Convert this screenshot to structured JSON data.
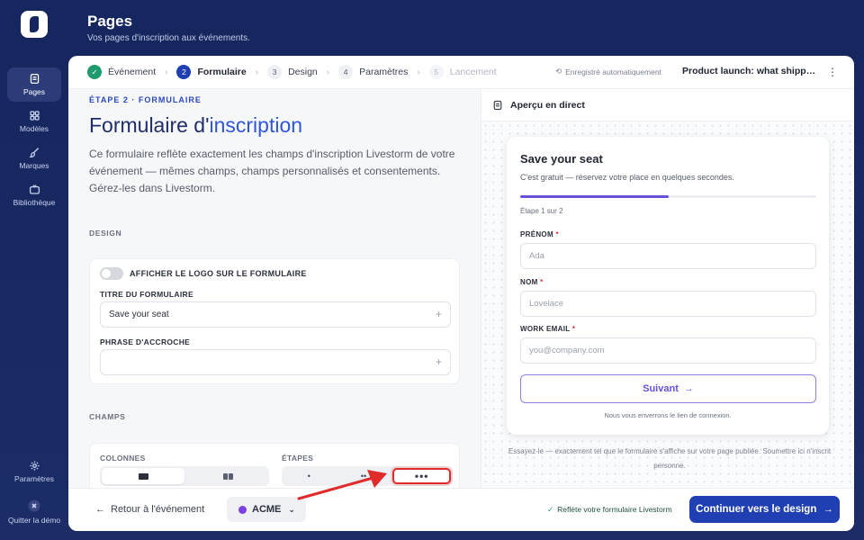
{
  "app": {
    "title": "Pages",
    "subtitle": "Vos pages d'inscription aux événements."
  },
  "sidebar": {
    "items": [
      {
        "label": "Pages",
        "icon": "pages-icon",
        "active": true
      },
      {
        "label": "Modèles",
        "icon": "grid-icon",
        "active": false
      },
      {
        "label": "Marques",
        "icon": "brush-icon",
        "active": false
      },
      {
        "label": "Bibliothèque",
        "icon": "tv-icon",
        "active": false
      }
    ],
    "bottom_items": [
      {
        "label": "Paramètres",
        "icon": "gear-icon"
      },
      {
        "label": "Quitter la démo",
        "icon": "exit-icon"
      }
    ]
  },
  "stepper": {
    "steps": [
      {
        "num": "1",
        "label": "Événement",
        "state": "done"
      },
      {
        "num": "2",
        "label": "Formulaire",
        "state": "current"
      },
      {
        "num": "3",
        "label": "Design",
        "state": "todo"
      },
      {
        "num": "4",
        "label": "Paramètres",
        "state": "todo"
      },
      {
        "num": "5",
        "label": "Lancement",
        "state": "disabled"
      }
    ],
    "autosave": "Enregistré automatiquement",
    "event_name": "Product launch: what shipped t..."
  },
  "form_editor": {
    "eyebrow": "ÉTAPE 2 · FORMULAIRE",
    "title_prefix": "Formulaire d'",
    "title_accent": "inscription",
    "description": "Ce formulaire reflète exactement les champs d'inscription Livestorm de votre événement — mêmes champs, champs personnalisés et consentements. Gérez-les dans Livestorm.",
    "design_section": "DESIGN",
    "show_logo_label": "AFFICHER LE LOGO SUR LE FORMULAIRE",
    "form_title_label": "TITRE DU FORMULAIRE",
    "form_title_value": "Save your seat",
    "tagline_label": "PHRASE D'ACCROCHE",
    "tagline_value": "",
    "fields_section": "CHAMPS",
    "columns_label": "COLONNES",
    "steps_label": "ÉTAPES"
  },
  "bottom_bar": {
    "back_label": "Retour à l'événement",
    "brand": "ACME",
    "brand_color": "#7b3fe4",
    "reflects": "Reflète votre formulaire Livestorm",
    "continue_label": "Continuer vers le design"
  },
  "preview": {
    "header": "Aperçu en direct",
    "card_title": "Save your seat",
    "tagline": "C'est gratuit — réservez votre place en quelques secondes.",
    "step_text": "Étape 1 sur 2",
    "progress": 0.5,
    "fields": [
      {
        "label": "PRÉNOM",
        "placeholder": "Ada"
      },
      {
        "label": "NOM",
        "placeholder": "Lovelace"
      },
      {
        "label": "WORK EMAIL",
        "placeholder": "you@company.com"
      }
    ],
    "required_mark": "*",
    "next_label": "Suivant",
    "note": "Nous vous enverrons le lien de connexion.",
    "caption": "Essayez-le — exactement tel que le formulaire s'affiche sur votre page publiée. Soumettre ici n'inscrit personne."
  },
  "colors": {
    "navy_bg": "#16265e",
    "primary": "#1f3fb3",
    "accent_purple": "#6a4fd8",
    "success": "#1e9b6e",
    "annotation_red": "#e02b2b"
  }
}
